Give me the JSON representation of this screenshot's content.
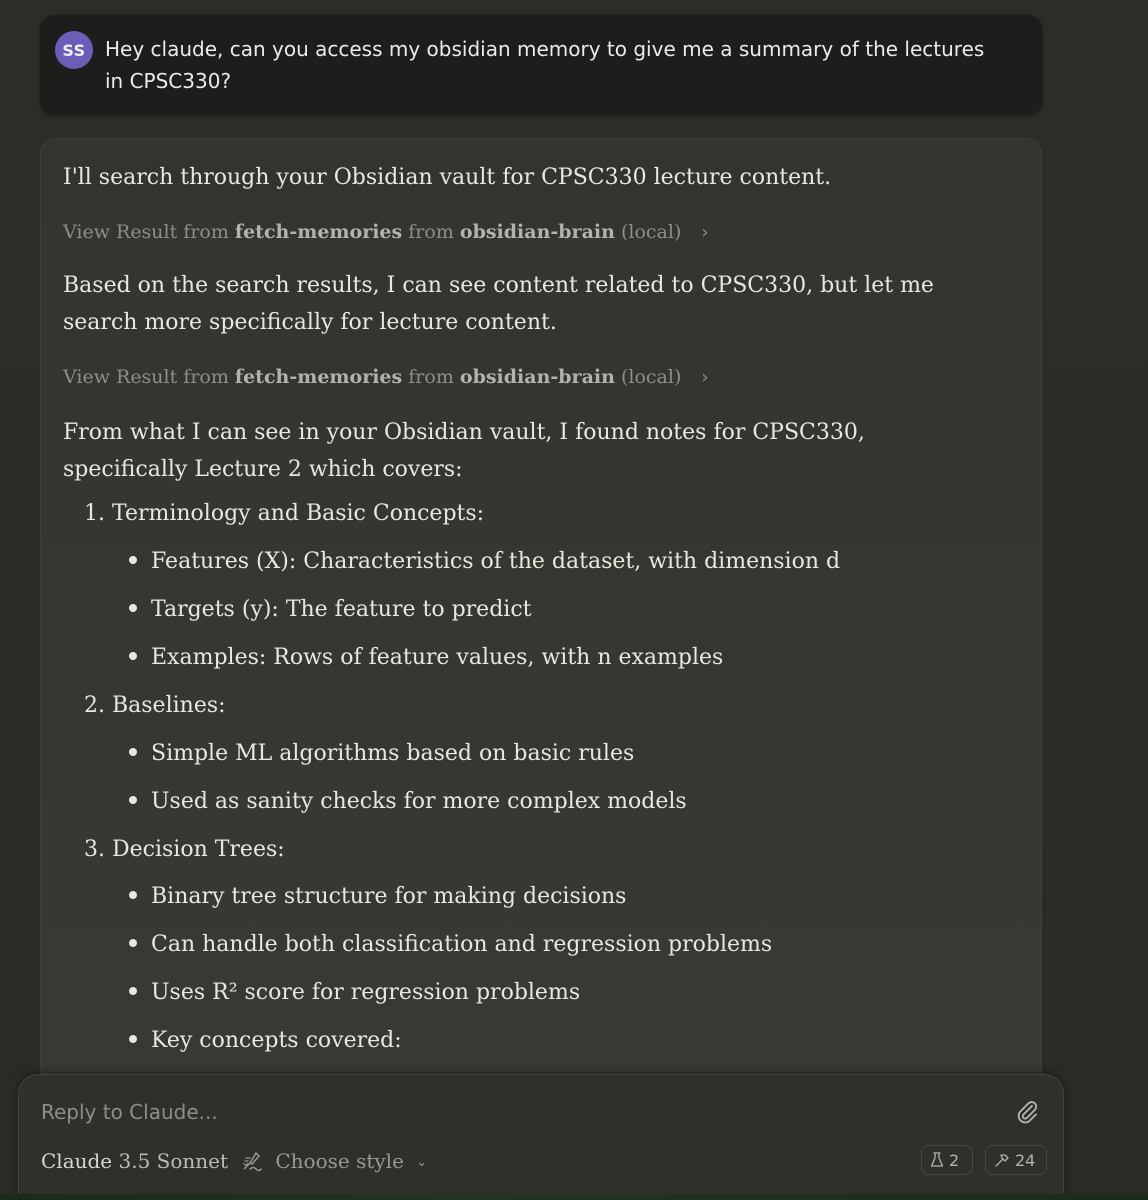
{
  "user_message": {
    "avatar_initials": "SS",
    "avatar_color": "#6b5eb8",
    "text": "Hey claude, can you access my obsidian memory to give me a summary of the lectures in CPSC330?"
  },
  "assistant": {
    "intro": "I'll search through your Obsidian vault for CPSC330 lecture content.",
    "tool_results": [
      {
        "prefix": "View Result from",
        "tool": "fetch-memories",
        "mid": "from",
        "server": "obsidian-brain",
        "suffix": "(local)"
      },
      {
        "prefix": "View Result from",
        "tool": "fetch-memories",
        "mid": "from",
        "server": "obsidian-brain",
        "suffix": "(local)"
      }
    ],
    "followup": "Based on the search results, I can see content related to CPSC330, but let me search more specifically for lecture content.",
    "found": "From what I can see in your Obsidian vault, I found notes for CPSC330, specifically Lecture 2 which covers:",
    "sections": [
      {
        "title": "1. Terminology and Basic Concepts:",
        "bullets": [
          "Features (X): Characteristics of the dataset, with dimension d",
          "Targets (y): The feature to predict",
          "Examples: Rows of feature values, with n examples"
        ]
      },
      {
        "title": "2. Baselines:",
        "bullets": [
          "Simple ML algorithms based on basic rules",
          "Used as sanity checks for more complex models"
        ]
      },
      {
        "title": "3. Decision Trees:",
        "bullets": [
          "Binary tree structure for making decisions",
          "Can handle both classification and regression problems",
          "Uses R² score for regression problems",
          "Key concepts covered:"
        ]
      }
    ]
  },
  "composer": {
    "placeholder": "Reply to Claude...",
    "model_name": "Claude",
    "model_version": "3.5 Sonnet",
    "style_label": "Choose style",
    "flask_count": "2",
    "tools_count": "24",
    "icons": [
      "paperclip-icon",
      "chevron-down-icon",
      "style-icon",
      "flask-icon",
      "hammer-icon",
      "chevron-right-icon"
    ]
  }
}
